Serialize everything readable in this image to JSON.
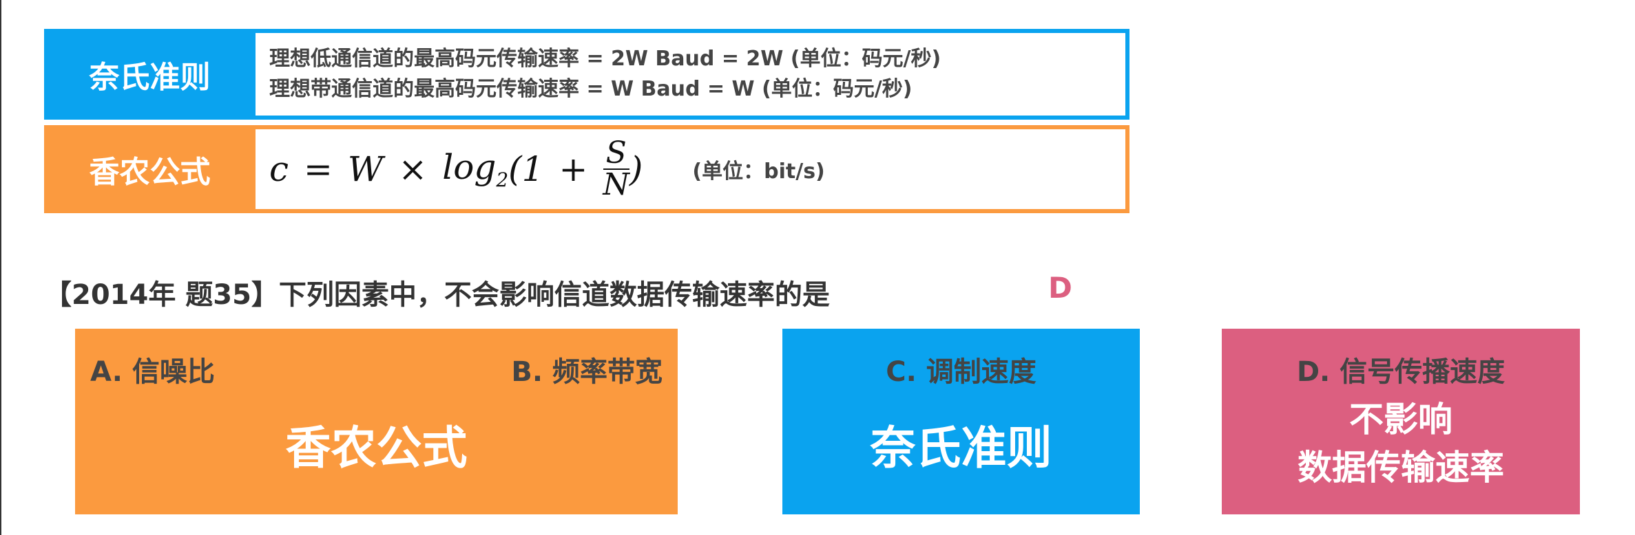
{
  "colors": {
    "blue": "#0aa3ef",
    "orange": "#fb9a3f",
    "pink": "#dc5f80"
  },
  "nyquist": {
    "label": "奈氏准则",
    "lines": [
      "理想低通信道的最高码元传输速率 = 2W Baud = 2W (单位：码元/秒)",
      "理想带通信道的最高码元传输速率 = W Baud = W (单位：码元/秒)"
    ]
  },
  "shannon": {
    "label": "香农公式",
    "formula": {
      "c": "c",
      "eq": "=",
      "W": "W",
      "times": "×",
      "log": "log",
      "base": "2",
      "open": "(1",
      "plus": "+",
      "num": "S",
      "den": "N",
      "close": ")"
    },
    "unit": "(单位：bit/s)"
  },
  "question": {
    "text": "【2014年 题35】下列因素中，不会影响信道数据传输速率的是",
    "answer": "D"
  },
  "options": {
    "a": "A. 信噪比",
    "b": "B. 频率带宽",
    "ab_big": "香农公式",
    "c": "C. 调制速度",
    "c_big": "奈氏准则",
    "d": "D. 信号传播速度",
    "d_big1": "不影响",
    "d_big2": "数据传输速率"
  }
}
